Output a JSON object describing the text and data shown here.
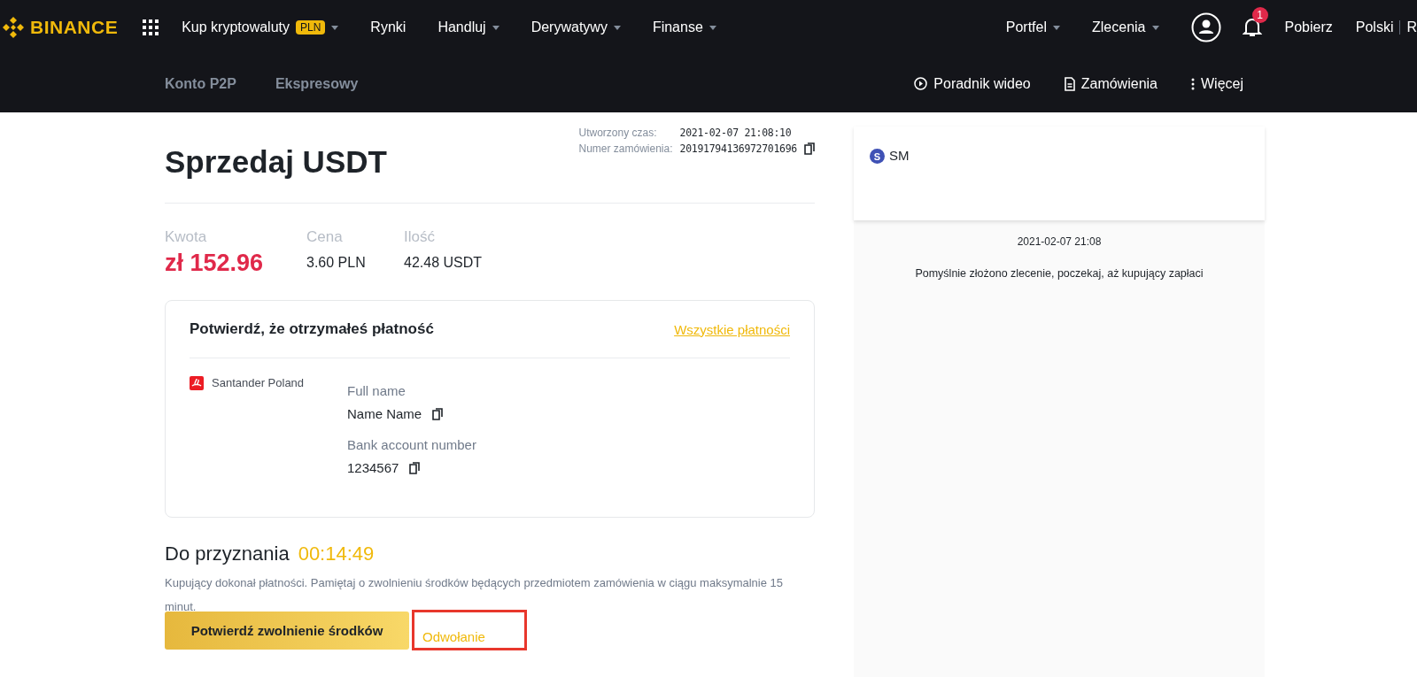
{
  "header": {
    "logo": "BINANCE",
    "nav": [
      {
        "label": "Kup kryptowaluty",
        "badge": "PLN",
        "dropdown": true
      },
      {
        "label": "Rynki",
        "dropdown": false
      },
      {
        "label": "Handluj",
        "dropdown": true
      },
      {
        "label": "Derywatywy",
        "dropdown": true
      },
      {
        "label": "Finanse",
        "dropdown": true
      }
    ],
    "right": [
      {
        "label": "Portfel",
        "dropdown": true
      },
      {
        "label": "Zlecenia",
        "dropdown": true
      }
    ],
    "notifications": "1",
    "download": "Pobierz",
    "language": "Polski",
    "currency": "R"
  },
  "subnav": {
    "tabs": [
      {
        "label": "Konto P2P"
      },
      {
        "label": "Ekspresowy"
      }
    ],
    "actions": [
      {
        "label": "Poradnik wideo",
        "kind": "video"
      },
      {
        "label": "Zamówienia",
        "kind": "document"
      },
      {
        "label": "Więcej",
        "kind": "more"
      }
    ]
  },
  "order": {
    "title": "Sprzedaj USDT",
    "created_label": "Utworzony czas:",
    "created_value": "2021-02-07 21:08:10",
    "number_label": "Numer zamówienia:",
    "number_value": "20191794136972701696",
    "stats": [
      {
        "label": "Kwota",
        "value": "zł 152.96",
        "kind": "amount"
      },
      {
        "label": "Cena",
        "value": "3.60 PLN",
        "kind": "plain"
      },
      {
        "label": "Ilość",
        "value": "42.48 USDT",
        "kind": "plain"
      }
    ]
  },
  "payment": {
    "title": "Potwierdź, że otrzymałeś płatność",
    "link": "Wszystkie płatności",
    "bank": "Santander Poland",
    "fields": [
      {
        "label": "Full name",
        "value": "Name Name"
      },
      {
        "label": "Bank account number",
        "value": "1234567"
      }
    ]
  },
  "release": {
    "label": "Do przyznania",
    "time": "00:14:49",
    "note": "Kupujący dokonał płatności. Pamiętaj o zwolnieniu środków będących przedmiotem zamówienia w ciągu maksymalnie 15 minut.",
    "confirm": "Potwierdź zwolnienie środków",
    "appeal": {
      "label": "Odwołanie",
      "highlighted": true
    }
  },
  "chat": {
    "avatar": "S",
    "name": "SM",
    "time": "2021-02-07 21:08",
    "message": "Pomyślnie złożono zlecenie, poczekaj, aż kupujący zapłaci"
  }
}
